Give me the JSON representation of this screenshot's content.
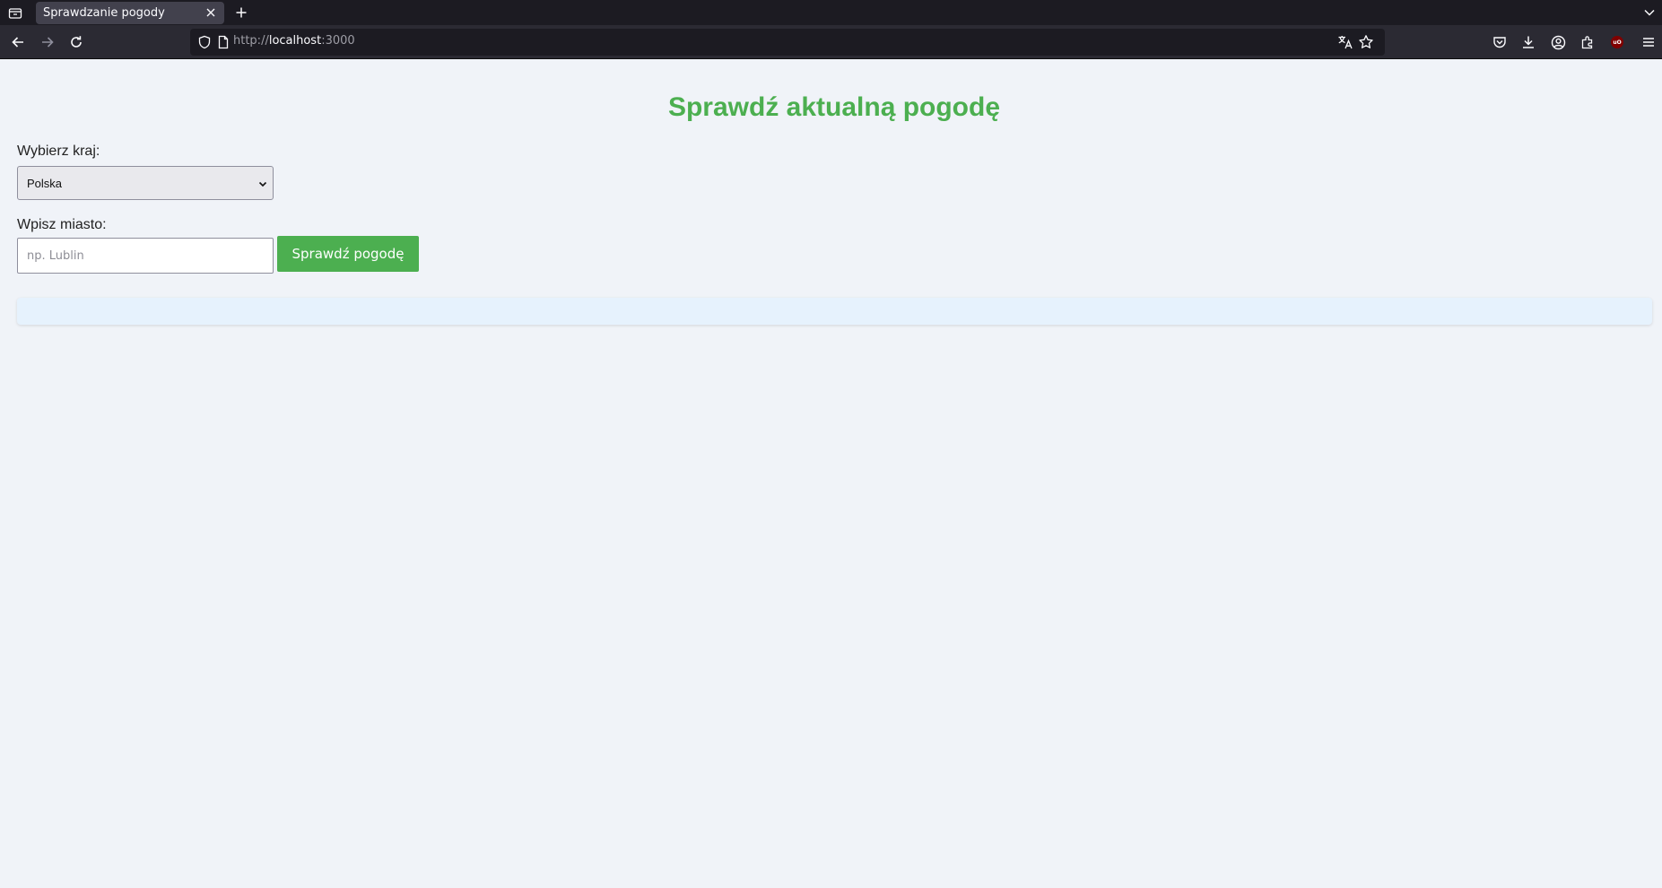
{
  "browser": {
    "tab": {
      "title": "Sprawdzanie pogody"
    },
    "url": {
      "scheme": "http://",
      "host": "localhost",
      "port": ":3000"
    }
  },
  "page": {
    "title": "Sprawdź aktualną pogodę",
    "country_label": "Wybierz kraj:",
    "country_selected": "Polska",
    "city_label": "Wpisz miasto:",
    "city_value": "",
    "city_placeholder": "np. Lublin",
    "submit_label": "Sprawdź pogodę"
  },
  "colors": {
    "accent": "#4caf50",
    "page_background": "#f0f3f8",
    "result_background": "#e6f2fd",
    "chrome_dark": "#1c1b22",
    "chrome_toolbar": "#2b2a33"
  },
  "icons": {
    "tab_list": "tab-list-icon",
    "close_tab": "close-icon",
    "new_tab": "plus-icon",
    "back": "back-arrow-icon",
    "forward": "forward-arrow-icon",
    "reload": "reload-icon",
    "site_security": "shield-icon",
    "page": "page-icon",
    "translate": "translate-icon",
    "bookmark": "star-icon",
    "pocket": "pocket-icon",
    "downloads": "download-icon",
    "account": "account-icon",
    "extensions": "extensions-icon",
    "ublock": "ublock-origin-icon",
    "menu": "hamburger-menu-icon",
    "tabs_overflow": "chevron-down-icon",
    "select_chevron": "chevron-down-icon"
  }
}
